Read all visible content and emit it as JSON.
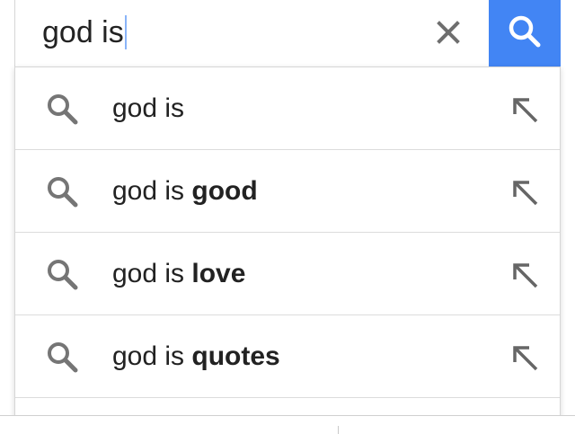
{
  "search": {
    "query": "god is",
    "icons": {
      "clear": "close-icon",
      "submit": "search-icon"
    },
    "accent_color": "#4285f4"
  },
  "suggestions": [
    {
      "prefix": "god is",
      "completion": "",
      "icon": "search-icon",
      "action_icon": "arrow-up-left-icon"
    },
    {
      "prefix": "god is ",
      "completion": "good",
      "icon": "search-icon",
      "action_icon": "arrow-up-left-icon"
    },
    {
      "prefix": "god is ",
      "completion": "love",
      "icon": "search-icon",
      "action_icon": "arrow-up-left-icon"
    },
    {
      "prefix": "god is ",
      "completion": "quotes",
      "icon": "search-icon",
      "action_icon": "arrow-up-left-icon"
    }
  ]
}
